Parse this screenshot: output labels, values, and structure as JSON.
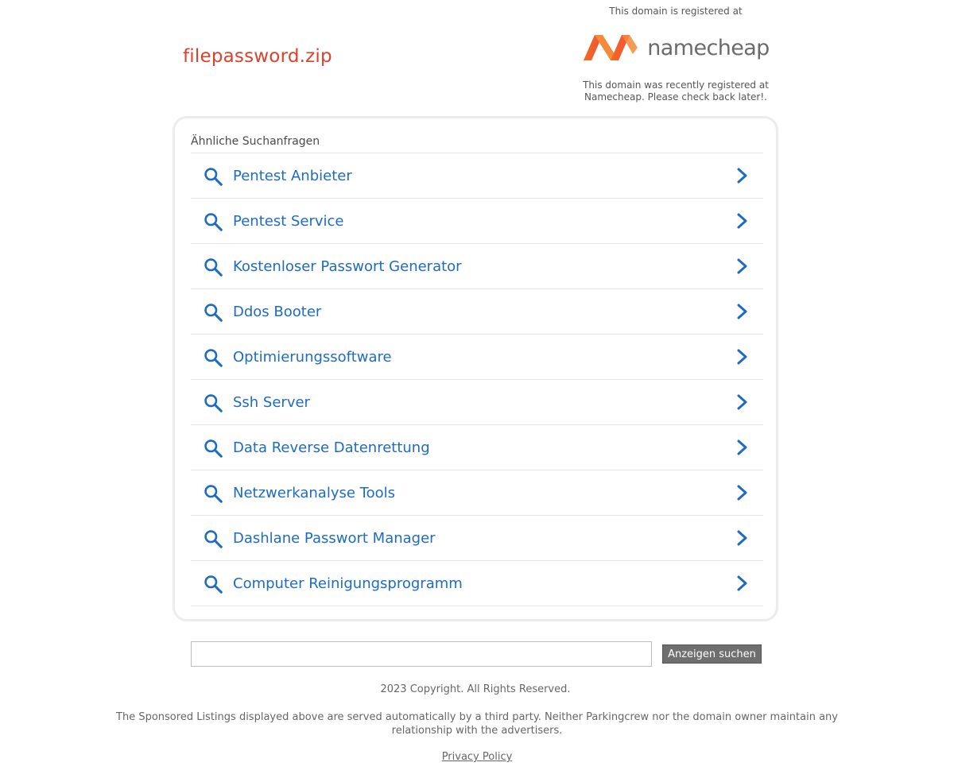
{
  "domain": {
    "name": "filepassword.zip",
    "color": "#d9432c"
  },
  "registrar": {
    "top_note": "This domain is registered at",
    "logo_text": "namecheap",
    "logo_icon": "namecheap-logo-icon",
    "logo_color": "#f05a28",
    "bottom_note_line1": "This domain was recently registered at",
    "bottom_note_line2": "Namecheap. Please check back later!."
  },
  "related": {
    "title": "Ähnliche Suchanfragen",
    "link_color": "#1e6bc4",
    "items": [
      {
        "label": "Pentest Anbieter"
      },
      {
        "label": "Pentest Service"
      },
      {
        "label": "Kostenloser Passwort Generator"
      },
      {
        "label": "Ddos Booter"
      },
      {
        "label": "Optimierungssoftware"
      },
      {
        "label": "Ssh Server"
      },
      {
        "label": "Data Reverse Datenrettung"
      },
      {
        "label": "Netzwerkanalyse Tools"
      },
      {
        "label": "Dashlane Passwort Manager"
      },
      {
        "label": "Computer Reinigungsprogramm"
      }
    ]
  },
  "search": {
    "value": "",
    "button_label": "Anzeigen suchen"
  },
  "footer": {
    "copyright": "2023 Copyright. All Rights Reserved.",
    "disclaimer_line1": "The Sponsored Listings displayed above are served automatically by a third party. Neither Parkingcrew nor the domain owner maintain any",
    "disclaimer_line2": "relationship with the advertisers.",
    "privacy_label": "Privacy Policy"
  }
}
